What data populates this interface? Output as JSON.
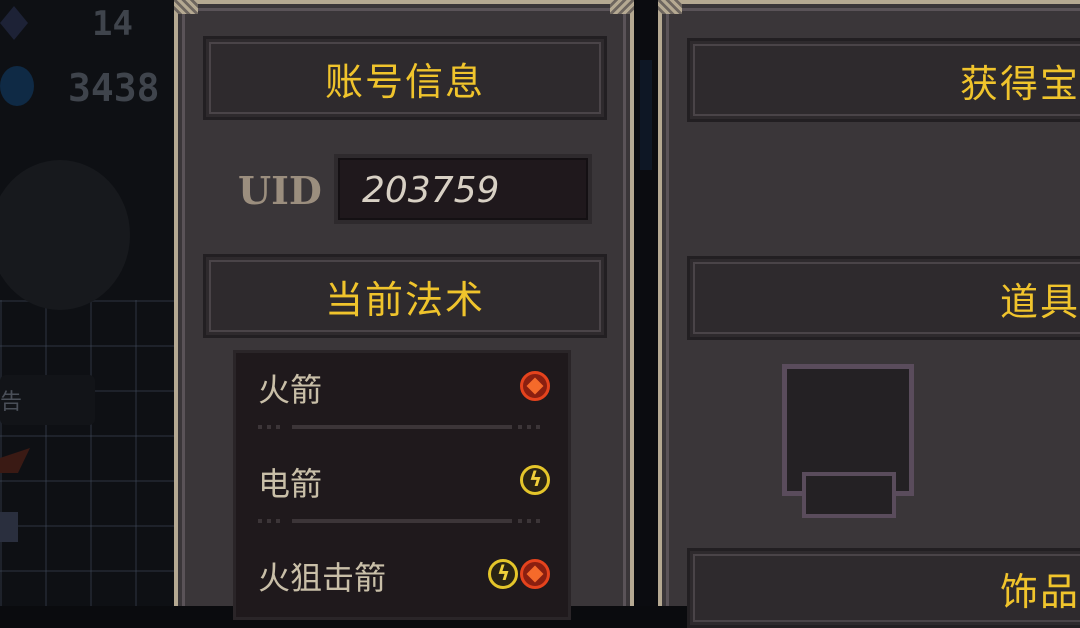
{
  "background": {
    "crystal_count": "14",
    "gem_count": "3438",
    "partial_text": "告"
  },
  "account_panel": {
    "account_header": "账号信息",
    "uid_label": "UID",
    "uid_value": "203759",
    "spells_header": "当前法术",
    "spells": [
      {
        "name": "火箭",
        "elements": [
          "fire"
        ]
      },
      {
        "name": "电箭",
        "elements": [
          "lightning"
        ]
      },
      {
        "name": "火狙击箭",
        "elements": [
          "lightning",
          "fire"
        ]
      }
    ]
  },
  "treasure_panel": {
    "treasure_header": "获得宝",
    "items_header": "道具",
    "accessory_header": "饰品"
  },
  "colors": {
    "header_text": "#f0c42c",
    "panel_bg": "#3a3639",
    "panel_border": "#b5a992",
    "fire": "#e5431d",
    "lightning": "#e4c52a"
  }
}
